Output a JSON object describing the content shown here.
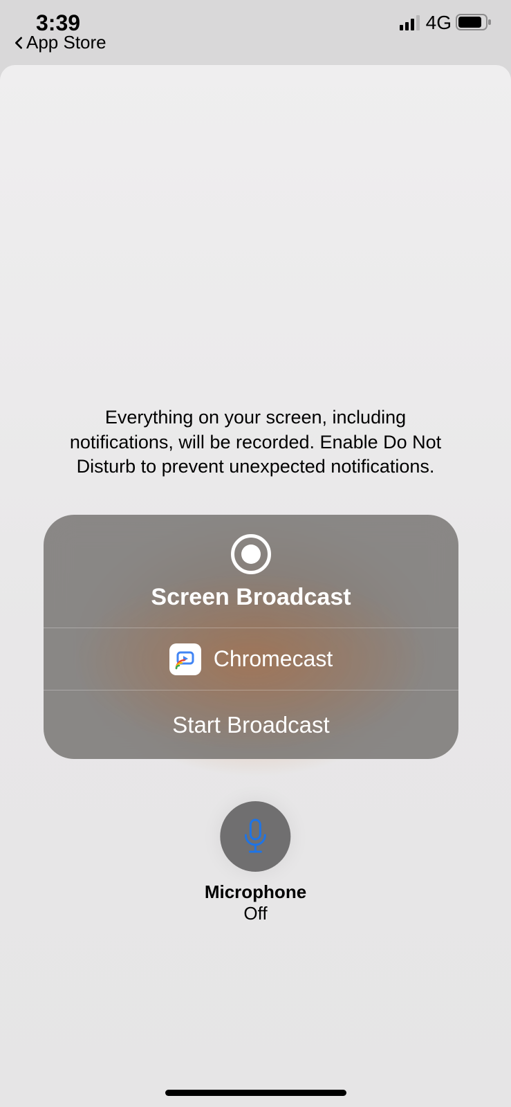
{
  "status": {
    "time": "3:39",
    "back_label": "App Store",
    "network": "4G"
  },
  "info_text": "Everything on your screen, including notifications, will be recorded. Enable Do Not Disturb to prevent unexpected notifications.",
  "card": {
    "title": "Screen Broadcast",
    "target_app": "Chromecast",
    "start_label": "Start Broadcast"
  },
  "mic": {
    "label": "Microphone",
    "state": "Off"
  }
}
